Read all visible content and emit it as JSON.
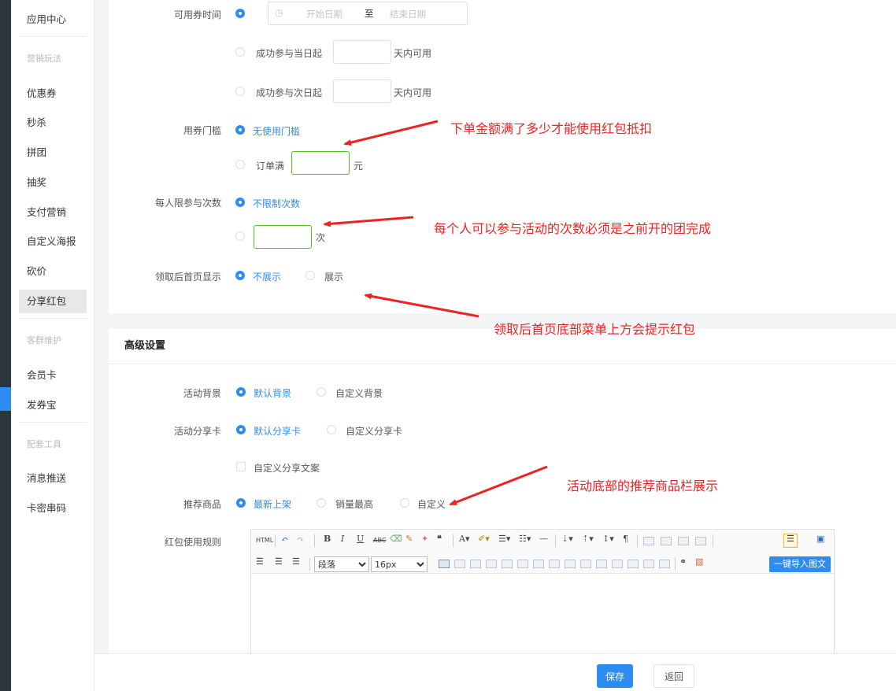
{
  "sidebar": {
    "items": [
      {
        "label": "应用中心",
        "type": "item"
      },
      {
        "label": "营销玩法",
        "type": "group"
      },
      {
        "label": "优惠券",
        "type": "item"
      },
      {
        "label": "秒杀",
        "type": "item"
      },
      {
        "label": "拼团",
        "type": "item"
      },
      {
        "label": "抽奖",
        "type": "item"
      },
      {
        "label": "支付营销",
        "type": "item"
      },
      {
        "label": "自定义海报",
        "type": "item"
      },
      {
        "label": "砍价",
        "type": "item"
      },
      {
        "label": "分享红包",
        "type": "item",
        "active": true
      },
      {
        "label": "客群维护",
        "type": "group"
      },
      {
        "label": "会员卡",
        "type": "item"
      },
      {
        "label": "发券宝",
        "type": "item"
      },
      {
        "label": "配套工具",
        "type": "group"
      },
      {
        "label": "消息推送",
        "type": "item"
      },
      {
        "label": "卡密串码",
        "type": "item"
      }
    ]
  },
  "form": {
    "valid_time": {
      "label": "可用券时间",
      "start_placeholder": "开始日期",
      "to": "至",
      "end_placeholder": "结束日期",
      "same_day_prefix": "成功参与当日起",
      "same_day_suffix": "天内可用",
      "next_day_prefix": "成功参与次日起",
      "next_day_suffix": "天内可用"
    },
    "threshold": {
      "label": "用券门槛",
      "option_none": "无使用门槛",
      "option_order_prefix": "订单满",
      "option_order_suffix": "元"
    },
    "limit": {
      "label": "每人限参与次数",
      "option_unlimited": "不限制次数",
      "option_times_suffix": "次"
    },
    "homepage": {
      "label": "领取后首页显示",
      "option_hide": "不展示",
      "option_show": "展示"
    }
  },
  "advanced": {
    "title": "高级设置",
    "background": {
      "label": "活动背景",
      "option_default": "默认背景",
      "option_custom": "自定义背景"
    },
    "share_card": {
      "label": "活动分享卡",
      "option_default": "默认分享卡",
      "option_custom": "自定义分享卡",
      "custom_text": "自定义分享文案"
    },
    "recommend": {
      "label": "推荐商品",
      "option_latest": "最新上架",
      "option_top_sales": "销量最高",
      "option_custom": "自定义"
    },
    "rules": {
      "label": "红包使用规则",
      "paragraph_select": "段落",
      "fontsize_select": "16px",
      "import_button": "一键导入图文"
    }
  },
  "annotations": {
    "threshold": "下单金额满了多少才能使用红包抵扣",
    "limit": "每个人可以参与活动的次数必须是之前开的团完成",
    "homepage": "领取后首页底部菜单上方会提示红包",
    "recommend": "活动底部的推荐商品栏展示"
  },
  "footer": {
    "save": "保存",
    "back": "返回"
  },
  "colors": {
    "primary": "#2d8cf0",
    "annotation": "#ee2222",
    "input_focus": "#52c41a",
    "sidebar_dark": "#2b3540"
  }
}
